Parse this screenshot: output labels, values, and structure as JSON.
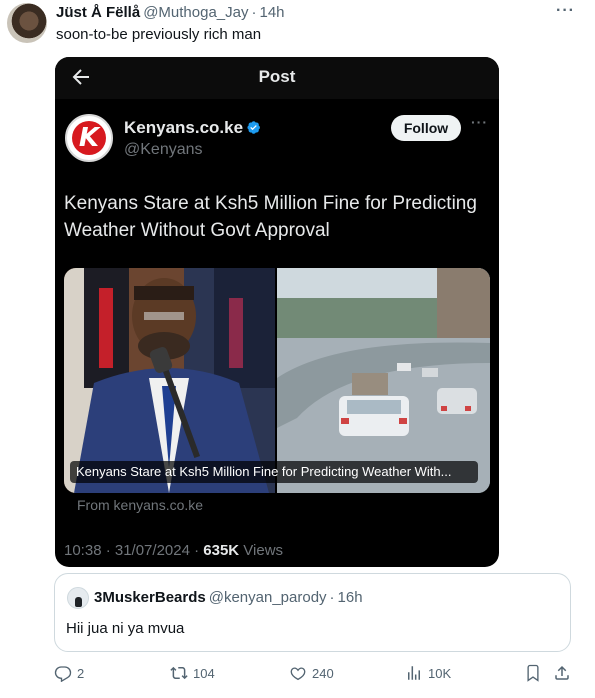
{
  "tweet": {
    "author_name": "Jüst Å Fëllå",
    "author_handle": "@Muthoga_Jay",
    "separator": "·",
    "time": "14h",
    "more": "···",
    "text": "soon-to-be previously rich man"
  },
  "screenshot": {
    "title": "Post",
    "account_name": "Kenyans.co.ke",
    "account_handle": "@Kenyans",
    "follow_label": "Follow",
    "more": "···",
    "logo_letter": "K",
    "headline": "Kenyans Stare at Ksh5 Million Fine for Predicting Weather Without Govt Approval",
    "card_caption": "Kenyans Stare at Ksh5 Million Fine for Predicting Weather With...",
    "card_source": "From kenyans.co.ke",
    "timestamp": "10:38 · 31/07/2024 · ",
    "views_count": "635K",
    "views_label": " Views"
  },
  "quote": {
    "name": "3MuskerBeards",
    "handle": "@kenyan_parody",
    "separator": "·",
    "time": "16h",
    "text": "Hii jua ni ya mvua"
  },
  "actions": {
    "replies": "2",
    "reposts": "104",
    "likes": "240",
    "views": "10K"
  },
  "icons": {
    "reply": "reply-icon",
    "repost": "repost-icon",
    "like": "heart-icon",
    "views": "analytics-icon",
    "bookmark": "bookmark-icon",
    "share": "share-icon"
  },
  "colors": {
    "verified": "#1d9bf0",
    "logo_red": "#d7191f",
    "muted": "#536471"
  }
}
